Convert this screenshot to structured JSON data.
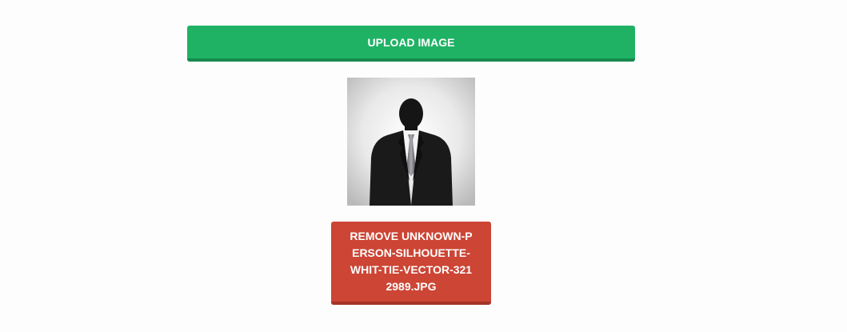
{
  "upload": {
    "label": "UPLOAD IMAGE"
  },
  "preview": {
    "icon": "person-silhouette-icon"
  },
  "remove": {
    "label": "REMOVE UNKNOWN-PERSON-SILHOUETTE-WHIT-TIE-VECTOR-3212989.JPG"
  },
  "colors": {
    "upload_bg": "#1fb265",
    "remove_bg": "#cc4535"
  }
}
